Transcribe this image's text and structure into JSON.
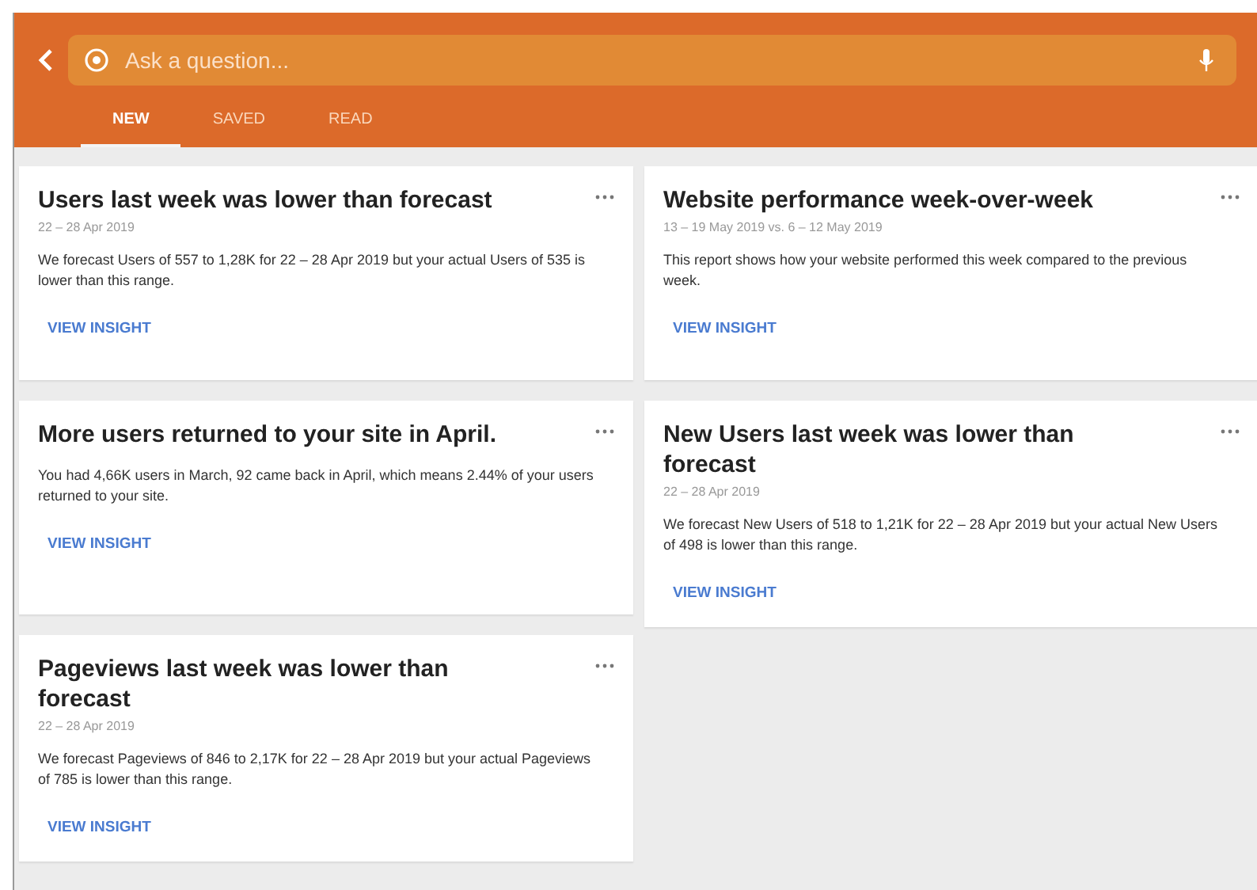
{
  "search": {
    "placeholder": "Ask a question..."
  },
  "tabs": [
    {
      "label": "NEW",
      "selected": true
    },
    {
      "label": "SAVED",
      "selected": false
    },
    {
      "label": "READ",
      "selected": false
    }
  ],
  "columns": [
    {
      "cards": [
        {
          "title": "Users last week was lower than forecast",
          "date": "22 – 28 Apr 2019",
          "body": "We forecast Users of 557 to 1,28K for 22 – 28 Apr 2019 but your actual Users of 535 is lower than this range.",
          "link": "VIEW INSIGHT"
        },
        {
          "title": "More users returned to your site in April.",
          "body": "You had 4,66K users in March, 92 came back in April, which means 2.44% of your users returned to your site.",
          "link": "VIEW INSIGHT"
        },
        {
          "title": "Pageviews last week was lower than forecast",
          "date": "22 – 28 Apr 2019",
          "body": "We forecast Pageviews of 846 to 2,17K for 22 – 28 Apr 2019 but your actual Pageviews of 785 is lower than this range.",
          "link": "VIEW INSIGHT"
        }
      ]
    },
    {
      "cards": [
        {
          "title": "Website performance week-over-week",
          "date": "13 – 19 May 2019 vs. 6 – 12 May 2019",
          "body": "This report shows how your website performed this week compared to the previous week.",
          "link": "VIEW INSIGHT"
        },
        {
          "title": "New Users last week was lower than forecast",
          "date": "22 – 28 Apr 2019",
          "body": "We forecast New Users of 518 to 1,21K for 22 – 28 Apr 2019 but your actual New Users of 498 is lower than this range.",
          "link": "VIEW INSIGHT"
        }
      ]
    }
  ]
}
